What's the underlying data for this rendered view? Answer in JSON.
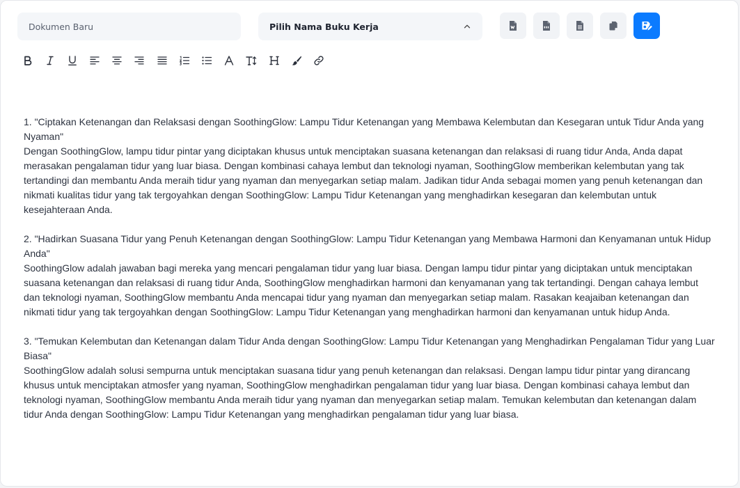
{
  "header": {
    "document_name_placeholder": "Dokumen Baru",
    "workbook_select_label": "Pilih Nama Buku Kerja",
    "actions": [
      {
        "name": "export-word",
        "icon": "word-file-icon",
        "primary": false
      },
      {
        "name": "export-pdf",
        "icon": "pdf-file-icon",
        "primary": false
      },
      {
        "name": "export-text",
        "icon": "text-file-icon",
        "primary": false
      },
      {
        "name": "copy",
        "icon": "copy-icon",
        "primary": false
      },
      {
        "name": "save",
        "icon": "save-edit-icon",
        "primary": true
      }
    ],
    "primary_color": "#0b7bff"
  },
  "toolbar": {
    "tools": [
      "bold",
      "italic",
      "underline",
      "align-left",
      "align-center",
      "align-right",
      "justify",
      "ordered-list",
      "unordered-list",
      "font-color",
      "font-size",
      "heading",
      "highlight-brush",
      "link"
    ]
  },
  "document": {
    "paragraphs": [
      {
        "title": "1. \"Ciptakan Ketenangan dan Relaksasi dengan SoothingGlow: Lampu Tidur Ketenangan yang Membawa Kelembutan dan Kesegaran untuk Tidur Anda yang Nyaman\"",
        "body": "Dengan SoothingGlow, lampu tidur pintar yang diciptakan khusus untuk menciptakan suasana ketenangan dan relaksasi di ruang tidur Anda, Anda dapat merasakan pengalaman tidur yang luar biasa. Dengan kombinasi cahaya lembut dan teknologi nyaman, SoothingGlow memberikan kelembutan yang tak tertandingi dan membantu Anda meraih tidur yang nyaman dan menyegarkan setiap malam. Jadikan tidur Anda sebagai momen yang penuh ketenangan dan nikmati kualitas tidur yang tak tergoyahkan dengan SoothingGlow: Lampu Tidur Ketenangan yang menghadirkan kesegaran dan kelembutan untuk kesejahteraan Anda."
      },
      {
        "title": "2. \"Hadirkan Suasana Tidur yang Penuh Ketenangan dengan SoothingGlow: Lampu Tidur Ketenangan yang Membawa Harmoni dan Kenyamanan untuk Hidup Anda\"",
        "body": "SoothingGlow adalah jawaban bagi mereka yang mencari pengalaman tidur yang luar biasa. Dengan lampu tidur pintar yang diciptakan untuk menciptakan suasana ketenangan dan relaksasi di ruang tidur Anda, SoothingGlow menghadirkan harmoni dan kenyamanan yang tak tertandingi. Dengan cahaya lembut dan teknologi nyaman, SoothingGlow membantu Anda mencapai tidur yang nyaman dan menyegarkan setiap malam. Rasakan keajaiban ketenangan dan nikmati tidur yang tak tergoyahkan dengan SoothingGlow: Lampu Tidur Ketenangan yang menghadirkan harmoni dan kenyamanan untuk hidup Anda."
      },
      {
        "title": "3. \"Temukan Kelembutan dan Ketenangan dalam Tidur Anda dengan SoothingGlow: Lampu Tidur Ketenangan yang Menghadirkan Pengalaman Tidur yang Luar Biasa\"",
        "body": "SoothingGlow adalah solusi sempurna untuk menciptakan suasana tidur yang penuh ketenangan dan relaksasi. Dengan lampu tidur pintar yang dirancang khusus untuk menciptakan atmosfer yang nyaman, SoothingGlow menghadirkan pengalaman tidur yang luar biasa. Dengan kombinasi cahaya lembut dan teknologi nyaman, SoothingGlow membantu Anda meraih tidur yang nyaman dan menyegarkan setiap malam. Temukan kelembutan dan ketenangan dalam tidur Anda dengan SoothingGlow: Lampu Tidur Ketenangan yang menghadirkan pengalaman tidur yang luar biasa."
      }
    ]
  }
}
